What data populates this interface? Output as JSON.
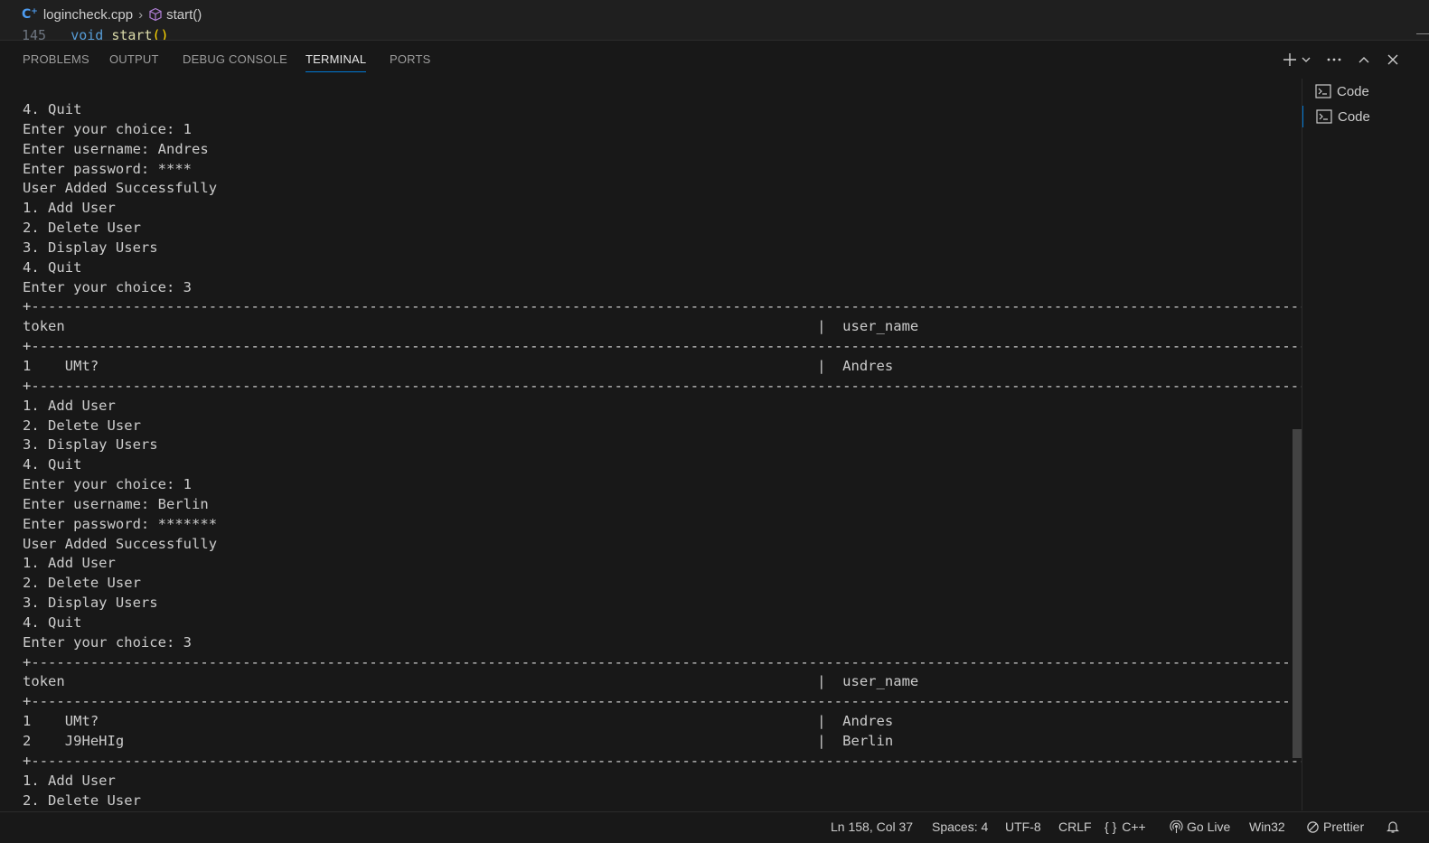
{
  "breadcrumb": {
    "file": "logincheck.cpp",
    "symbol": "start()",
    "file_icon": "cpp-file-icon",
    "symbol_icon": "method-cube-icon"
  },
  "code_peek": {
    "line_number": "145",
    "keyword": "void",
    "function": "start",
    "parens": "()"
  },
  "panel": {
    "tabs": [
      "PROBLEMS",
      "OUTPUT",
      "DEBUG CONSOLE",
      "TERMINAL",
      "PORTS"
    ],
    "active_tab": "TERMINAL",
    "actions": [
      "new-terminal-icon",
      "chevron-down-icon",
      "more-actions-icon",
      "maximize-panel-icon",
      "close-icon"
    ]
  },
  "terminal": {
    "lines": [
      "4. Quit",
      "Enter your choice: 1",
      "Enter username: Andres",
      "Enter password: ****",
      "User Added Successfully",
      "1. Add User",
      "2. Delete User",
      "3. Display Users",
      "4. Quit",
      "Enter your choice: 3",
      "+-------------------------------------------------------------------------------------------------------------------------------------------------------------------------+",
      "token                                                                                         |  user_name                                                             |",
      "+-------------------------------------------------------------------------------------------------------------------------------------------------------------------------+",
      "1    UMt?                                                                                     |  Andres                                                                |",
      "+-------------------------------------------------------------------------------------------------------------------------------------------------------------------------+",
      "1. Add User",
      "2. Delete User",
      "3. Display Users",
      "4. Quit",
      "Enter your choice: 1",
      "Enter username: Berlin",
      "Enter password: *******",
      "User Added Successfully",
      "1. Add User",
      "2. Delete User",
      "3. Display Users",
      "4. Quit",
      "Enter your choice: 3",
      "+-------------------------------------------------------------------------------------------------------------------------------------------------------------------------+",
      "token                                                                                         |  user_name                                                             |",
      "+-------------------------------------------------------------------------------------------------------------------------------------------------------------------------+",
      "1    UMt?                                                                                     |  Andres                                                                |",
      "2    J9HeHIg                                                                                  |  Berlin                                                                |",
      "+-------------------------------------------------------------------------------------------------------------------------------------------------------------------------+",
      "1. Add User",
      "2. Delete User"
    ]
  },
  "terminal_list": {
    "items": [
      "Code",
      "Code"
    ],
    "active_index": 1,
    "item_icon": "terminal-icon"
  },
  "statusbar": {
    "position": "Ln 158, Col 37",
    "spaces": "Spaces: 4",
    "encoding": "UTF-8",
    "eol": "CRLF",
    "language_braces": "{ }",
    "language": "C++",
    "go_live": "Go Live",
    "platform": "Win32",
    "prettier": "Prettier",
    "bell_icon": "bell-icon"
  },
  "colors": {
    "background": "#181818",
    "accent": "#0078d4",
    "text": "#cccccc"
  }
}
